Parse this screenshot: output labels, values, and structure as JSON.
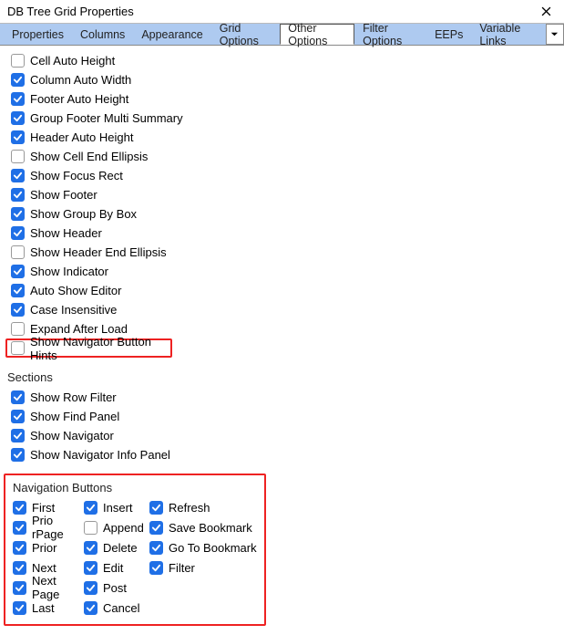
{
  "title": "DB Tree Grid Properties",
  "tabs": [
    {
      "label": "Properties",
      "active": false
    },
    {
      "label": "Columns",
      "active": false
    },
    {
      "label": "Appearance",
      "active": false
    },
    {
      "label": "Grid Options",
      "active": false
    },
    {
      "label": "Other Options",
      "active": true
    },
    {
      "label": "Filter Options",
      "active": false
    },
    {
      "label": "EEPs",
      "active": false
    },
    {
      "label": "Variable Links",
      "active": false
    }
  ],
  "options": [
    {
      "label": "Cell Auto Height",
      "checked": false,
      "highlight": false
    },
    {
      "label": "Column Auto Width",
      "checked": true,
      "highlight": false
    },
    {
      "label": "Footer Auto Height",
      "checked": true,
      "highlight": false
    },
    {
      "label": "Group Footer Multi Summary",
      "checked": true,
      "highlight": false
    },
    {
      "label": "Header Auto Height",
      "checked": true,
      "highlight": false
    },
    {
      "label": "Show Cell End Ellipsis",
      "checked": false,
      "highlight": false
    },
    {
      "label": "Show Focus Rect",
      "checked": true,
      "highlight": false
    },
    {
      "label": "Show Footer",
      "checked": true,
      "highlight": false
    },
    {
      "label": "Show Group By Box",
      "checked": true,
      "highlight": false
    },
    {
      "label": "Show Header",
      "checked": true,
      "highlight": false
    },
    {
      "label": "Show Header End Ellipsis",
      "checked": false,
      "highlight": false
    },
    {
      "label": "Show Indicator",
      "checked": true,
      "highlight": false
    },
    {
      "label": "Auto Show Editor",
      "checked": true,
      "highlight": false
    },
    {
      "label": "Case Insensitive",
      "checked": true,
      "highlight": false
    },
    {
      "label": "Expand After Load",
      "checked": false,
      "highlight": false
    },
    {
      "label": "Show Navigator Button Hints",
      "checked": false,
      "highlight": true
    }
  ],
  "sections_title": "Sections",
  "sections": [
    {
      "label": "Show Row Filter",
      "checked": true
    },
    {
      "label": "Show Find Panel",
      "checked": true
    },
    {
      "label": "Show Navigator",
      "checked": true
    },
    {
      "label": "Show Navigator Info Panel",
      "checked": true
    }
  ],
  "nav_title": "Navigation Buttons",
  "nav_buttons": [
    [
      {
        "label": "First",
        "checked": true
      },
      {
        "label": "Insert",
        "checked": true
      },
      {
        "label": "Refresh",
        "checked": true
      }
    ],
    [
      {
        "label": "Prio rPage",
        "checked": true
      },
      {
        "label": "Append",
        "checked": false
      },
      {
        "label": "Save Bookmark",
        "checked": true
      }
    ],
    [
      {
        "label": "Prior",
        "checked": true
      },
      {
        "label": "Delete",
        "checked": true
      },
      {
        "label": "Go To Bookmark",
        "checked": true
      }
    ],
    [
      {
        "label": "Next",
        "checked": true
      },
      {
        "label": "Edit",
        "checked": true
      },
      {
        "label": "Filter",
        "checked": true
      }
    ],
    [
      {
        "label": "Next Page",
        "checked": true
      },
      {
        "label": "Post",
        "checked": true
      }
    ],
    [
      {
        "label": "Last",
        "checked": true
      },
      {
        "label": "Cancel",
        "checked": true
      }
    ]
  ]
}
